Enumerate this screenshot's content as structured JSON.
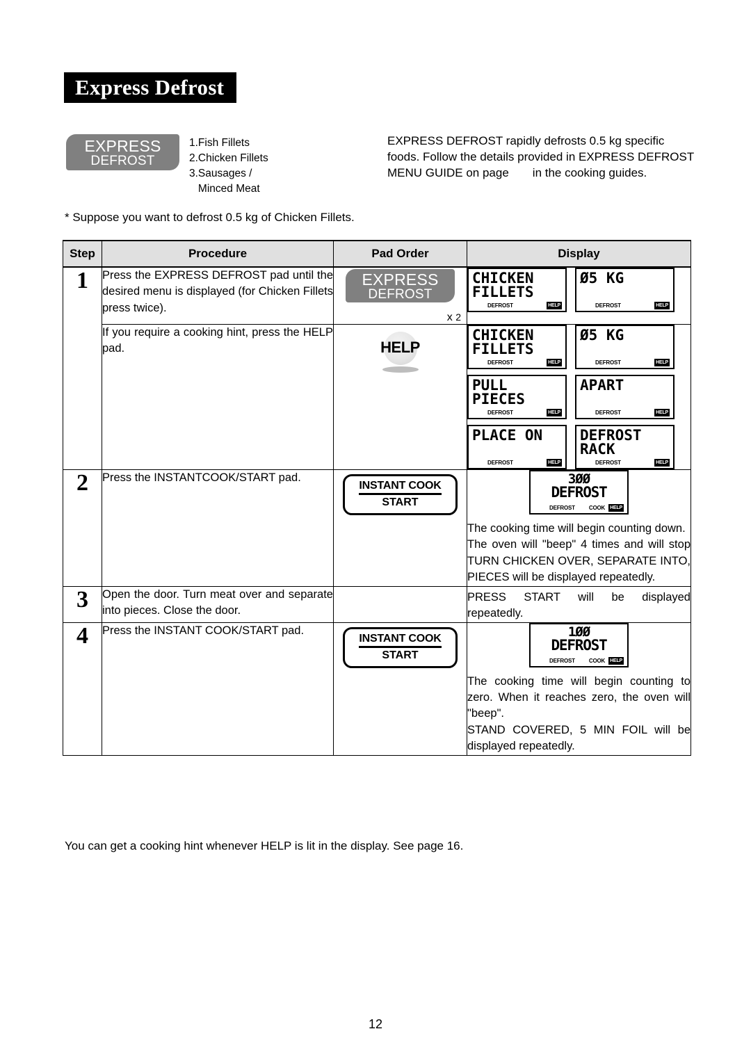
{
  "page": {
    "title": "Express Defrost",
    "page_number": "12"
  },
  "intro": {
    "pad": {
      "line1": "EXPRESS",
      "line2": "DEFROST"
    },
    "menu_items": "1.Fish Fillets\n2.Chicken Fillets\n3.Sausages /\n   Minced Meat",
    "paragraph_part1": "EXPRESS DEFROST rapidly defrosts 0.5 kg specific foods.",
    "paragraph_part2": "Follow the details provided in EXPRESS DEFROST MENU GUIDE on page",
    "paragraph_part3": "in the cooking guides.",
    "suppose": "* Suppose you want to defrost 0.5 kg of Chicken Fillets."
  },
  "table": {
    "headers": {
      "step": "Step",
      "procedure": "Procedure",
      "pad_order": "Pad Order",
      "display": "Display"
    },
    "rows": [
      {
        "step": "1",
        "sub_a": {
          "procedure": "Press the EXPRESS DEFROST pad until the desired menu is displayed (for Chicken Fillets press twice).",
          "pad": {
            "line1": "EXPRESS",
            "line2": "DEFROST",
            "multiplier_prefix": "x",
            "multiplier_count": "2"
          },
          "displays": [
            {
              "lines": "CHICKEN\nFILLETS",
              "ind_defrost": "DEFROST",
              "ind_help": "HELP"
            },
            {
              "lines": "05 KG",
              "ind_defrost": "DEFROST",
              "ind_help": "HELP"
            }
          ]
        },
        "sub_b": {
          "procedure": "If you require a cooking hint, press the HELP pad.",
          "pad_label": "HELP",
          "displays": [
            {
              "lines": "CHICKEN\nFILLETS",
              "ind_defrost": "DEFROST",
              "ind_help": "HELP"
            },
            {
              "lines": "05 KG",
              "ind_defrost": "DEFROST",
              "ind_help": "HELP"
            },
            {
              "lines": "PULL\nPIECES",
              "ind_defrost": "DEFROST",
              "ind_help": "HELP"
            },
            {
              "lines": "APART",
              "ind_defrost": "DEFROST",
              "ind_help": "HELP"
            },
            {
              "lines": "PLACE ON",
              "ind_defrost": "DEFROST",
              "ind_help": "HELP"
            },
            {
              "lines": "DEFROST\nRACK",
              "ind_defrost": "DEFROST",
              "ind_help": "HELP"
            }
          ]
        }
      },
      {
        "step": "2",
        "procedure": "Press the INSTANTCOOK/START pad.",
        "pad": {
          "line1": "INSTANT COOK",
          "line2": "START"
        },
        "display_time": {
          "number": "300",
          "word": "DEFROST",
          "ind_defrost": "DEFROST",
          "ind_cook": "COOK",
          "ind_help": "HELP"
        },
        "note": "The cooking time will begin counting down.\nThe oven will \"beep\" 4 times and will stop TURN CHICKEN OVER, SEPARATE INTO, PIECES will be displayed repeatedly."
      },
      {
        "step": "3",
        "procedure": "Open the door. Turn meat over and separate into pieces. Close the door.",
        "pad": null,
        "note": "PRESS START will be displayed repeatedly."
      },
      {
        "step": "4",
        "procedure": "Press the INSTANT COOK/START pad.",
        "pad": {
          "line1": "INSTANT COOK",
          "line2": "START"
        },
        "display_time": {
          "number": "100",
          "word": "DEFROST",
          "ind_defrost": "DEFROST",
          "ind_cook": "COOK",
          "ind_help": "HELP"
        },
        "note": "The cooking time will begin counting to zero. When it reaches zero, the oven will \"beep\".\nSTAND COVERED, 5 MIN FOIL will be displayed repeatedly."
      }
    ]
  },
  "footer": {
    "note": "You can get a cooking hint whenever HELP is lit in the display. See page 16."
  },
  "colors": {
    "pad_gray": "#808080",
    "header_gray": "#e0e0e0",
    "title_bg": "#000000"
  }
}
